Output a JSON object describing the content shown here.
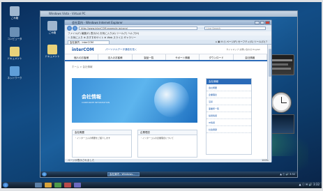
{
  "host": {
    "desktop_icons": [
      {
        "label": "ごみ箱",
        "color": "#9fb6cf"
      },
      {
        "label": "コンピュータ",
        "color": "#6a8fb5"
      },
      {
        "label": "ドキュメント",
        "color": "#e8d27a"
      },
      {
        "label": "ネットワーク",
        "color": "#5f9ed8"
      }
    ],
    "tray_text": "▲ ⓘ ✉ 🔊 3:32"
  },
  "vm": {
    "title": "Windows Vista - Virtual PC",
    "desktop_icons": [
      {
        "label": "ごみ箱",
        "color": "#9fb6cf"
      },
      {
        "label": "ドキュメント",
        "color": "#e8d27a"
      }
    ],
    "taskbar": {
      "task_label": "会社案内 - Windows...",
      "tray_text": "▲ ⓘ 🔊 3:32"
    }
  },
  "browser": {
    "title": "会社案内 - Windows Internet Explorer",
    "url": "http://www.interCOM.example.jp/corp/",
    "search_placeholder": "Live Search",
    "menu": "ファイル(F)  編集(E)  表示(V)  お気に入り(A)  ツール(T)  ヘルプ(H)",
    "favorites": "☆ お気に入り  ⊕ おすすめサイト  ⊕ Web スライス ギャラリー",
    "tab_label": "会社案内 - interCOM",
    "commands": "⌂  ▣  ✉  ⎙  ページ(P)  セーフティ(S)  ツール(O)  ?",
    "status": "ページが表示されました",
    "zoom": "100%",
    "page": {
      "logo": "interCOM",
      "tagline": "パーソナルデータ通信を拓く",
      "toplinks": "サイトマップ  お問い合わせ  English",
      "nav": [
        "個人のお客様",
        "法人のお客様",
        "製品一覧",
        "サポート情報",
        "ダウンロード",
        "会社情報"
      ],
      "breadcrumb": "ホーム > 会社情報",
      "hero_title": "会社情報",
      "hero_sub": "CORPORATE INFORMATION",
      "side_head": "会社情報",
      "side_items": [
        "会社概要",
        "企業理念",
        "沿革",
        "事業所一覧",
        "採用情報",
        "IR情報",
        "社会貢献"
      ],
      "boxes": [
        {
          "title": "会社概要",
          "line": "・インターコムの概要をご紹介します"
        },
        {
          "title": "企業理念",
          "line": "・インターコムの企業理念について"
        }
      ]
    }
  }
}
